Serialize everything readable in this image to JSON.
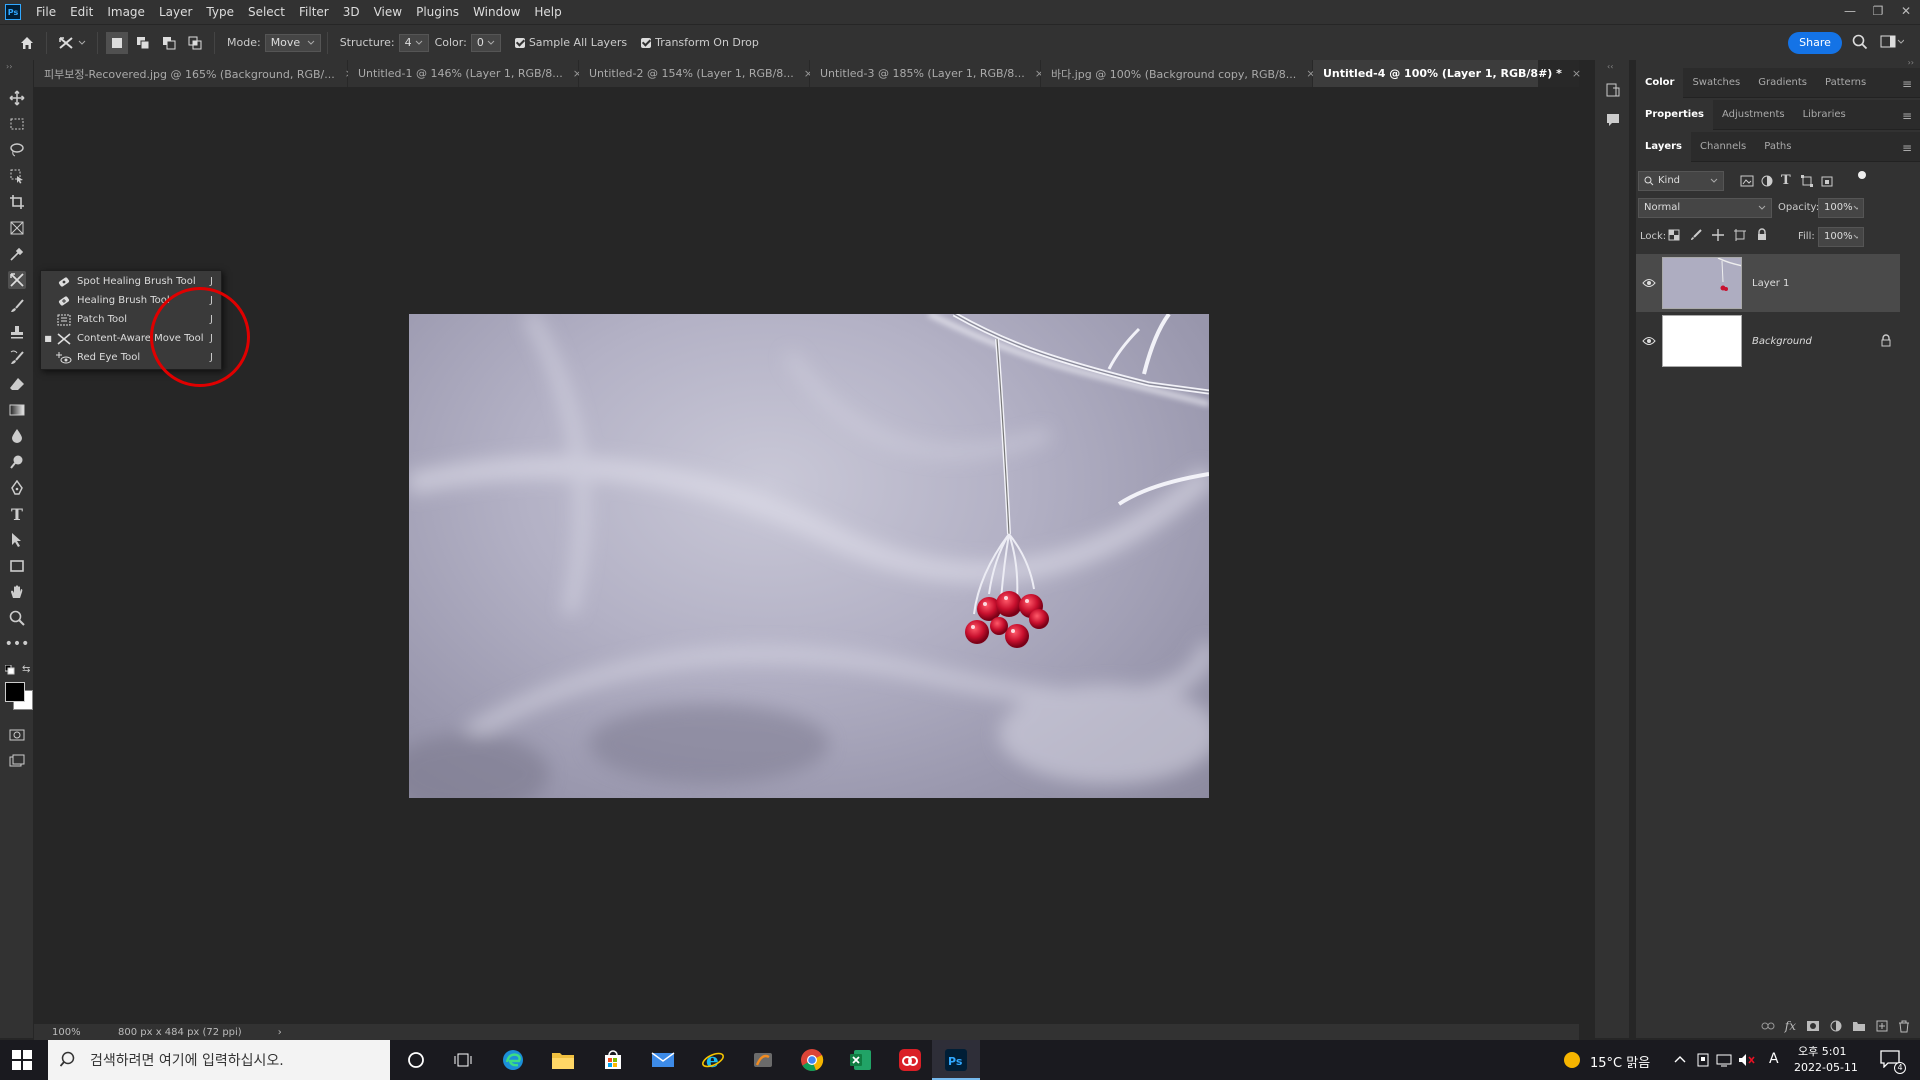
{
  "menubar": {
    "app_icon": "Ps",
    "items": [
      "File",
      "Edit",
      "Image",
      "Layer",
      "Type",
      "Select",
      "Filter",
      "3D",
      "View",
      "Plugins",
      "Window",
      "Help"
    ],
    "window_controls": [
      "—",
      "❐",
      "✕"
    ]
  },
  "options": {
    "mode_label": "Mode:",
    "mode_value": "Move",
    "structure_label": "Structure:",
    "structure_value": "4",
    "color_label": "Color:",
    "color_value": "0",
    "sample_all_layers": "Sample All Layers",
    "transform_on_drop": "Transform On Drop",
    "share": "Share"
  },
  "tabs": [
    {
      "label": "피부보정-Recovered.jpg @ 165% (Background, RGB/...",
      "close": "×"
    },
    {
      "label": "Untitled-1 @ 146% (Layer 1, RGB/8...",
      "close": "×"
    },
    {
      "label": "Untitled-2 @ 154% (Layer 1, RGB/8...",
      "close": "×"
    },
    {
      "label": "Untitled-3 @ 185% (Layer 1, RGB/8...",
      "close": "×"
    },
    {
      "label": "바다.jpg @ 100% (Background copy, RGB/8...",
      "close": "×"
    },
    {
      "label": "Untitled-4 @ 100% (Layer 1, RGB/8#) *",
      "close": "×"
    }
  ],
  "flyout": {
    "items": [
      {
        "label": "Spot Healing Brush Tool",
        "key": "J",
        "icon": "spot-healing-brush-icon",
        "selected": false
      },
      {
        "label": "Healing Brush Tool",
        "key": "J",
        "icon": "healing-brush-icon",
        "selected": false
      },
      {
        "label": "Patch Tool",
        "key": "J",
        "icon": "patch-icon",
        "selected": false
      },
      {
        "label": "Content-Aware Move Tool",
        "key": "J",
        "icon": "content-aware-move-icon",
        "selected": true
      },
      {
        "label": "Red Eye Tool",
        "key": "J",
        "icon": "red-eye-icon",
        "selected": false
      }
    ],
    "selected_marker": "■"
  },
  "status": {
    "zoom": "100%",
    "doc_info": "800 px x 484 px (72 ppi)",
    "arrow": "›"
  },
  "panels": {
    "tabs_row1": [
      "Color",
      "Swatches",
      "Gradients",
      "Patterns"
    ],
    "tabs_row2": [
      "Properties",
      "Adjustments",
      "Libraries"
    ],
    "tabs_row3": [
      "Layers",
      "Channels",
      "Paths"
    ],
    "menu_glyph": "≡",
    "kind_label": "Kind",
    "blend_mode": "Normal",
    "opacity_label": "Opacity:",
    "opacity_value": "100%",
    "lock_label": "Lock:",
    "fill_label": "Fill:",
    "fill_value": "100%",
    "layers": [
      {
        "name": "Layer 1",
        "selected": true
      },
      {
        "name": "Background",
        "selected": false,
        "locked": true
      }
    ]
  },
  "taskbar": {
    "search_placeholder": "검색하려면 여기에 입력하십시오.",
    "weather": "15°C 맑음",
    "ime": "A",
    "time": "오후 5:01",
    "date": "2022-05-11",
    "notification_count": "4"
  },
  "colors": {
    "accent": "#1473e6",
    "highlight_circle": "#e00000",
    "berries": "#c8102e"
  }
}
